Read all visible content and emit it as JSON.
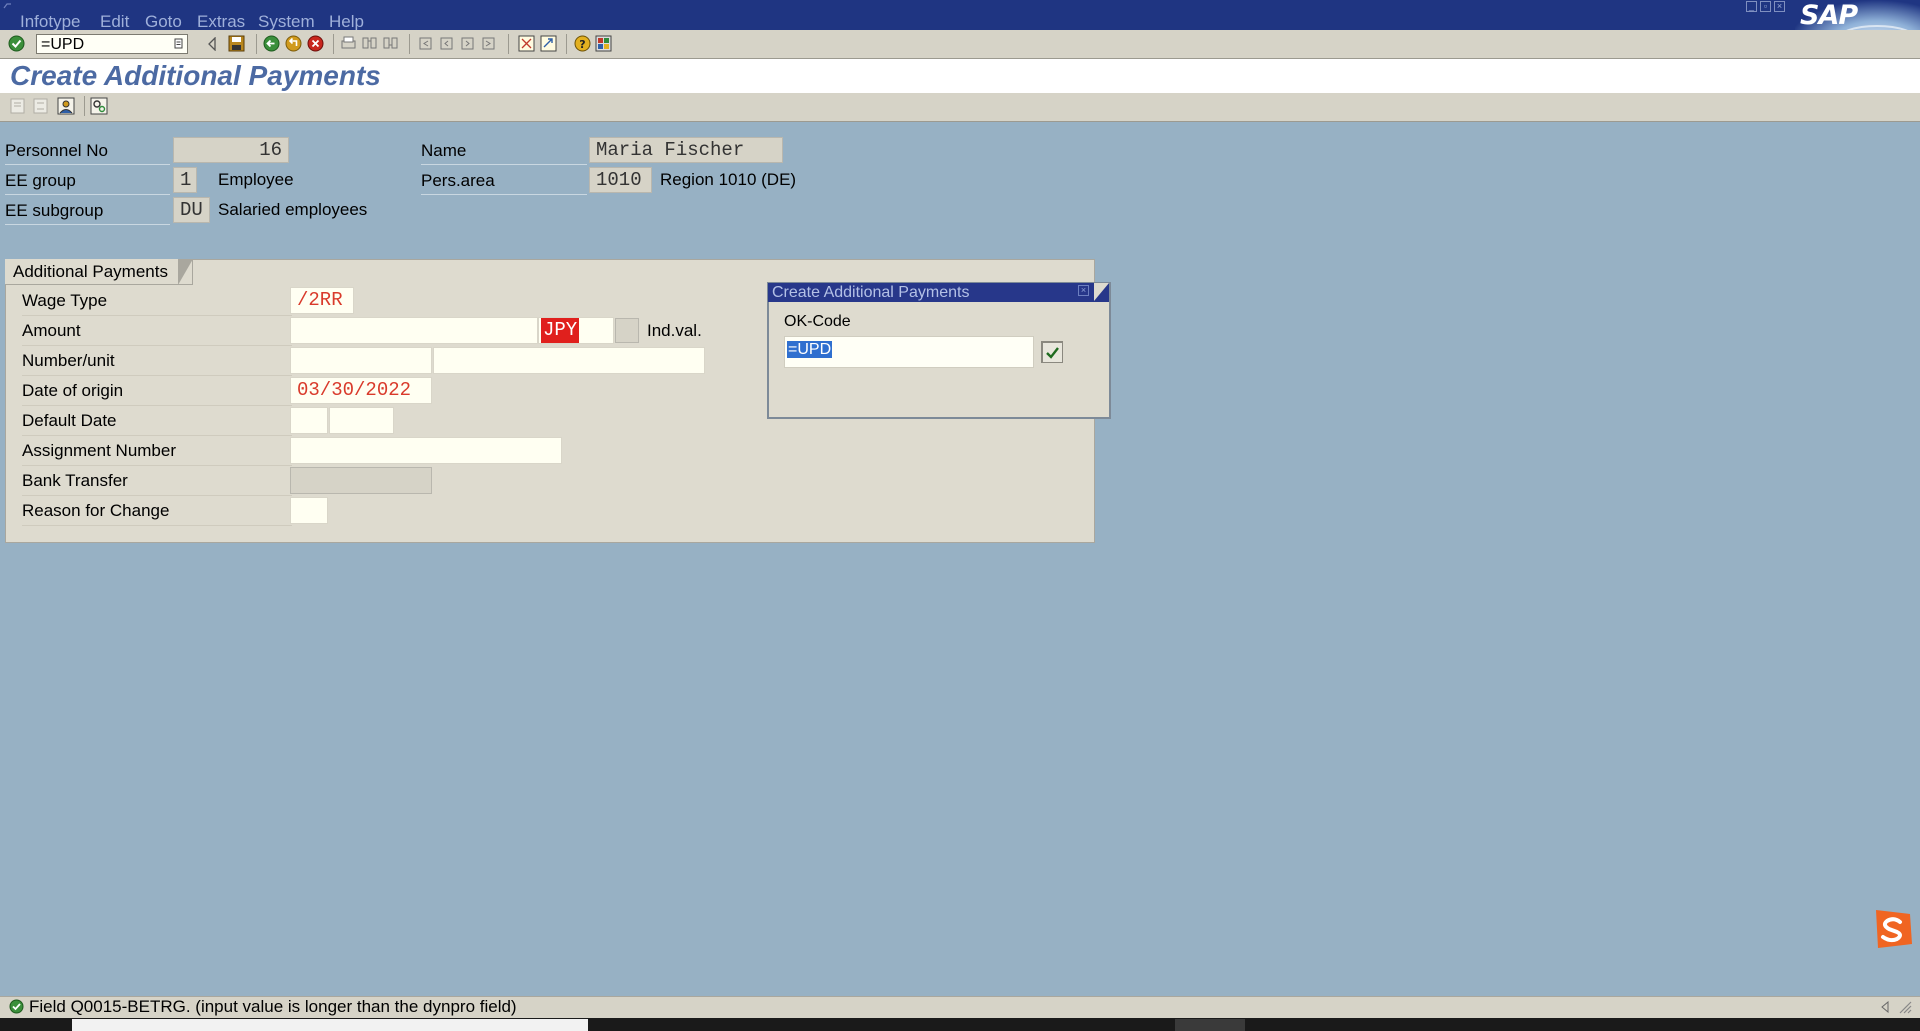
{
  "menu": {
    "items": [
      "Infotype",
      "Edit",
      "Goto",
      "Extras",
      "System",
      "Help"
    ]
  },
  "brand": {
    "logo_text": "SAP"
  },
  "toolbar": {
    "command_value": "=UPD",
    "icons": [
      "enter-icon",
      "back-triangle-icon",
      "save-icon",
      "back-icon",
      "exit-icon",
      "cancel-icon",
      "print-icon",
      "find-icon",
      "find-next-icon",
      "first-page-icon",
      "prev-page-icon",
      "next-page-icon",
      "last-page-icon",
      "new-session-icon",
      "shortcut-icon",
      "help-icon",
      "layout-icon"
    ]
  },
  "page": {
    "title": "Create Additional Payments"
  },
  "header": {
    "personnel_no_label": "Personnel No",
    "personnel_no": "16",
    "name_label": "Name",
    "name": "Maria Fischer",
    "ee_group_label": "EE group",
    "ee_group_code": "1",
    "ee_group_text": "Employee",
    "pers_area_label": "Pers.area",
    "pers_area_code": "1010",
    "pers_area_text": "Region 1010 (DE)",
    "ee_subgroup_label": "EE subgroup",
    "ee_subgroup_code": "DU",
    "ee_subgroup_text": "Salaried employees"
  },
  "group": {
    "title": "Additional Payments",
    "fields": {
      "wage_type_label": "Wage Type",
      "wage_type": "/2RR",
      "amount_label": "Amount",
      "amount": "",
      "currency": "JPY",
      "ind_val_label": "Ind.val.",
      "number_unit_label": "Number/unit",
      "date_origin_label": "Date of origin",
      "date_origin": "03/30/2022",
      "default_date_label": "Default Date",
      "assignment_label": "Assignment Number",
      "bank_transfer_label": "Bank Transfer",
      "reason_label": "Reason for Change"
    }
  },
  "popup": {
    "title": "Create Additional Payments",
    "label": "OK-Code",
    "value": "=UPD"
  },
  "status": {
    "message": "Field Q0015-BETRG. (input value is longer than the dynpro field)"
  },
  "colors": {
    "menubar": "#1f3582",
    "background": "#97b1c4",
    "title": "#4c6aa3",
    "field_text": "#d93a2b",
    "currency_bg": "#e0201d"
  }
}
